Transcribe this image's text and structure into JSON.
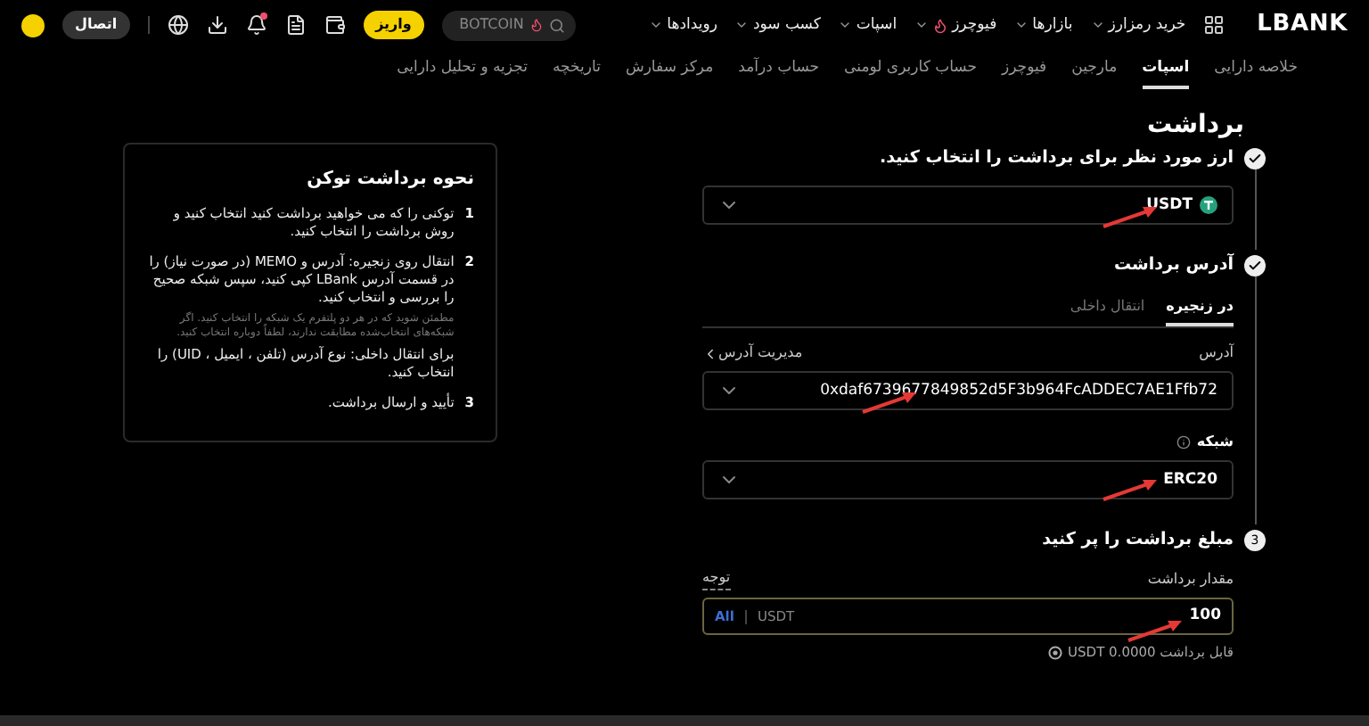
{
  "header": {
    "logo": "LBANK",
    "nav": [
      {
        "label": "خرید رمزارز",
        "hot": false
      },
      {
        "label": "بازارها",
        "hot": false
      },
      {
        "label": "فیوچرز",
        "hot": true
      },
      {
        "label": "اسپات",
        "hot": false
      },
      {
        "label": "کسب سود",
        "hot": false
      },
      {
        "label": "رویدادها",
        "hot": false
      }
    ],
    "search": {
      "value": "BOTCOIN"
    },
    "deposit_button": "واریز",
    "connect_button": "اتصال"
  },
  "tabs": [
    {
      "label": "خلاصه دارایی",
      "selected": false
    },
    {
      "label": "اسپات",
      "selected": true
    },
    {
      "label": "مارجین",
      "selected": false
    },
    {
      "label": "فیوچرز",
      "selected": false
    },
    {
      "label": "حساب کاربری لومنی",
      "selected": false
    },
    {
      "label": "حساب درآمد",
      "selected": false
    },
    {
      "label": "مرکز سفارش",
      "selected": false
    },
    {
      "label": "تاریخچه",
      "selected": false
    },
    {
      "label": "تجزیه و تحلیل دارایی",
      "selected": false
    }
  ],
  "page_title": "برداشت",
  "steps": [
    {
      "title": "ارز مورد نظر برای برداشت را انتخاب کنید.",
      "done": true
    },
    {
      "title": "آدرس برداشت",
      "done": true
    },
    {
      "title": "مبلغ برداشت را پر کنید",
      "done": false,
      "number": "3"
    }
  ],
  "coin": {
    "value": "USDT"
  },
  "address_tabs": [
    {
      "label": "در زنجیره",
      "selected": true
    },
    {
      "label": "انتقال داخلی",
      "selected": false
    }
  ],
  "address_label": "آدرس",
  "manage_link": "مدیریت آدرس",
  "address": "0xdaf6739677849852d5F3b964FcADDEC7AE1Ffb72",
  "network_label": "شبکه",
  "network": "ERC20",
  "amount_label": "مقدار برداشت",
  "note_link": "توجه",
  "amount": "100",
  "unit": "USDT",
  "all_button": "All",
  "available": "قابل برداشت USDT 0.0000",
  "guide": {
    "title": "نحوه برداشت توکن",
    "items": [
      {
        "number": "1",
        "paragraphs": [
          {
            "text": "توکنی را که می خواهید برداشت کنید انتخاب کنید و روش برداشت را انتخاب کنید.",
            "muted": false
          }
        ]
      },
      {
        "number": "2",
        "paragraphs": [
          {
            "text": "انتقال روی زنجیره: آدرس و MEMO (در صورت نیاز) را در قسمت آدرس LBank کپی کنید، سپس شبکه صحیح را بررسی و انتخاب کنید.",
            "muted": false
          },
          {
            "text": "مطمئن شوید که در هر دو پلتفرم یک شبکه را انتخاب کنید. اگر شبکه‌های انتخاب‌شده مطابقت ندارند، لطفاً دوباره انتخاب کنید.",
            "muted": true
          },
          {
            "text": "برای انتقال داخلی: نوع آدرس (تلفن ، ایمیل ، UID) را انتخاب کنید.",
            "muted": false
          }
        ]
      },
      {
        "number": "3",
        "paragraphs": [
          {
            "text": "تأیید و ارسال برداشت.",
            "muted": false
          }
        ]
      }
    ]
  }
}
